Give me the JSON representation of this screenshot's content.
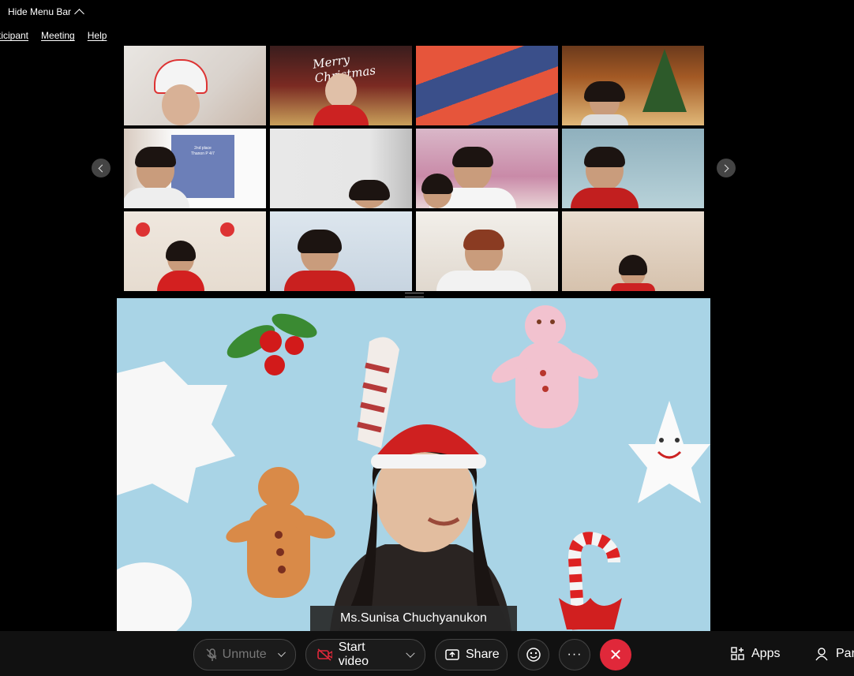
{
  "menu_bar": {
    "hide_label": "Hide Menu Bar",
    "items": [
      "rticipant",
      "Meeting",
      "Help"
    ]
  },
  "gallery": {
    "tile5_slide_text_line1": "2nd place",
    "tile5_slide_text_line2": "Thanon P 4/7",
    "tile2_overlay_text": "Merry Christmas"
  },
  "speaker": {
    "name": "Ms.Sunisa Chuchyanukon"
  },
  "toolbar": {
    "unmute_label": "Unmute",
    "video_label": "Start video",
    "share_label": "Share",
    "more_label": "···",
    "end_label": "✕",
    "apps_label": "Apps",
    "participants_label": "Par"
  },
  "colors": {
    "end_button": "#e0283a",
    "toolbar_bg": "#111111",
    "background": "#000000"
  }
}
